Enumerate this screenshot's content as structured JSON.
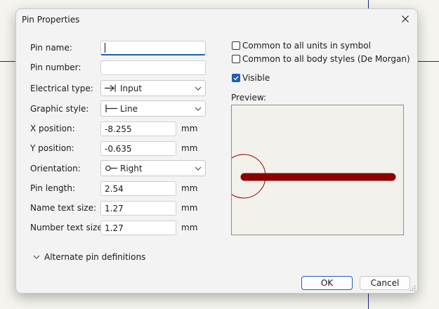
{
  "dialog": {
    "title": "Pin Properties"
  },
  "fields": {
    "pin_name": {
      "label": "Pin name:",
      "value": ""
    },
    "pin_number": {
      "label": "Pin number:",
      "value": ""
    },
    "electrical_type": {
      "label": "Electrical type:",
      "value": "Input",
      "icon": "input-pin-icon"
    },
    "graphic_style": {
      "label": "Graphic style:",
      "value": "Line",
      "icon": "line-style-icon"
    },
    "x_position": {
      "label": "X position:",
      "value": "-8.255",
      "unit": "mm"
    },
    "y_position": {
      "label": "Y position:",
      "value": "-0.635",
      "unit": "mm"
    },
    "orientation": {
      "label": "Orientation:",
      "value": "Right",
      "icon": "orientation-right-icon"
    },
    "pin_length": {
      "label": "Pin length:",
      "value": "2.54",
      "unit": "mm"
    },
    "name_text_size": {
      "label": "Name text size:",
      "value": "1.27",
      "unit": "mm"
    },
    "number_text_size": {
      "label": "Number text size:",
      "value": "1.27",
      "unit": "mm"
    }
  },
  "options": {
    "common_units": {
      "label": "Common to all units in symbol",
      "checked": false
    },
    "common_body_styles": {
      "label": "Common to all body styles (De Morgan)",
      "checked": false
    },
    "visible": {
      "label": "Visible",
      "checked": true
    }
  },
  "preview": {
    "label": "Preview:",
    "pin_color": "#8b0000"
  },
  "alternate": {
    "label": "Alternate pin definitions",
    "expanded": false
  },
  "buttons": {
    "ok": "OK",
    "cancel": "Cancel"
  },
  "colors": {
    "accent": "#1e5fb0",
    "pin": "#8b0000"
  }
}
